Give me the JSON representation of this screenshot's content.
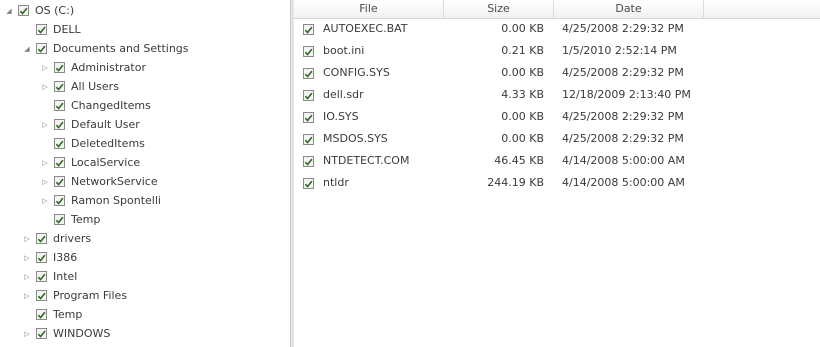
{
  "tree": {
    "items": [
      {
        "label": "OS (C:)",
        "expander": "expanded",
        "checked": true
      },
      {
        "label": "DELL",
        "expander": "none",
        "checked": true
      },
      {
        "label": "Documents and Settings",
        "expander": "expanded",
        "checked": true
      },
      {
        "label": "Administrator",
        "expander": "collapsed",
        "checked": true
      },
      {
        "label": "All Users",
        "expander": "collapsed",
        "checked": true
      },
      {
        "label": "ChangedItems",
        "expander": "none",
        "checked": true
      },
      {
        "label": "Default User",
        "expander": "collapsed",
        "checked": true
      },
      {
        "label": "DeletedItems",
        "expander": "none",
        "checked": true
      },
      {
        "label": "LocalService",
        "expander": "collapsed",
        "checked": true
      },
      {
        "label": "NetworkService",
        "expander": "collapsed",
        "checked": true
      },
      {
        "label": "Ramon Spontelli",
        "expander": "collapsed",
        "checked": true
      },
      {
        "label": "Temp",
        "expander": "none",
        "checked": true
      },
      {
        "label": "drivers",
        "expander": "collapsed",
        "checked": true
      },
      {
        "label": "I386",
        "expander": "collapsed",
        "checked": true
      },
      {
        "label": "Intel",
        "expander": "collapsed",
        "checked": true
      },
      {
        "label": "Program Files",
        "expander": "collapsed",
        "checked": true
      },
      {
        "label": "Temp",
        "expander": "none",
        "checked": true
      },
      {
        "label": "WINDOWS",
        "expander": "collapsed",
        "checked": true
      }
    ]
  },
  "list": {
    "columns": {
      "file": "File",
      "size": "Size",
      "date": "Date"
    },
    "rows": [
      {
        "name": "AUTOEXEC.BAT",
        "size": "0.00 KB",
        "date": "4/25/2008 2:29:32 PM",
        "checked": true
      },
      {
        "name": "boot.ini",
        "size": "0.21 KB",
        "date": "1/5/2010 2:52:14 PM",
        "checked": true
      },
      {
        "name": "CONFIG.SYS",
        "size": "0.00 KB",
        "date": "4/25/2008 2:29:32 PM",
        "checked": true
      },
      {
        "name": "dell.sdr",
        "size": "4.33 KB",
        "date": "12/18/2009 2:13:40 PM",
        "checked": true
      },
      {
        "name": "IO.SYS",
        "size": "0.00 KB",
        "date": "4/25/2008 2:29:32 PM",
        "checked": true
      },
      {
        "name": "MSDOS.SYS",
        "size": "0.00 KB",
        "date": "4/25/2008 2:29:32 PM",
        "checked": true
      },
      {
        "name": "NTDETECT.COM",
        "size": "46.45 KB",
        "date": "4/14/2008 5:00:00 AM",
        "checked": true
      },
      {
        "name": "ntldr",
        "size": "244.19 KB",
        "date": "4/14/2008 5:00:00 AM",
        "checked": true
      }
    ]
  },
  "colors": {
    "checkmark": "#2f6d1f",
    "text": "#3a3a3a"
  }
}
